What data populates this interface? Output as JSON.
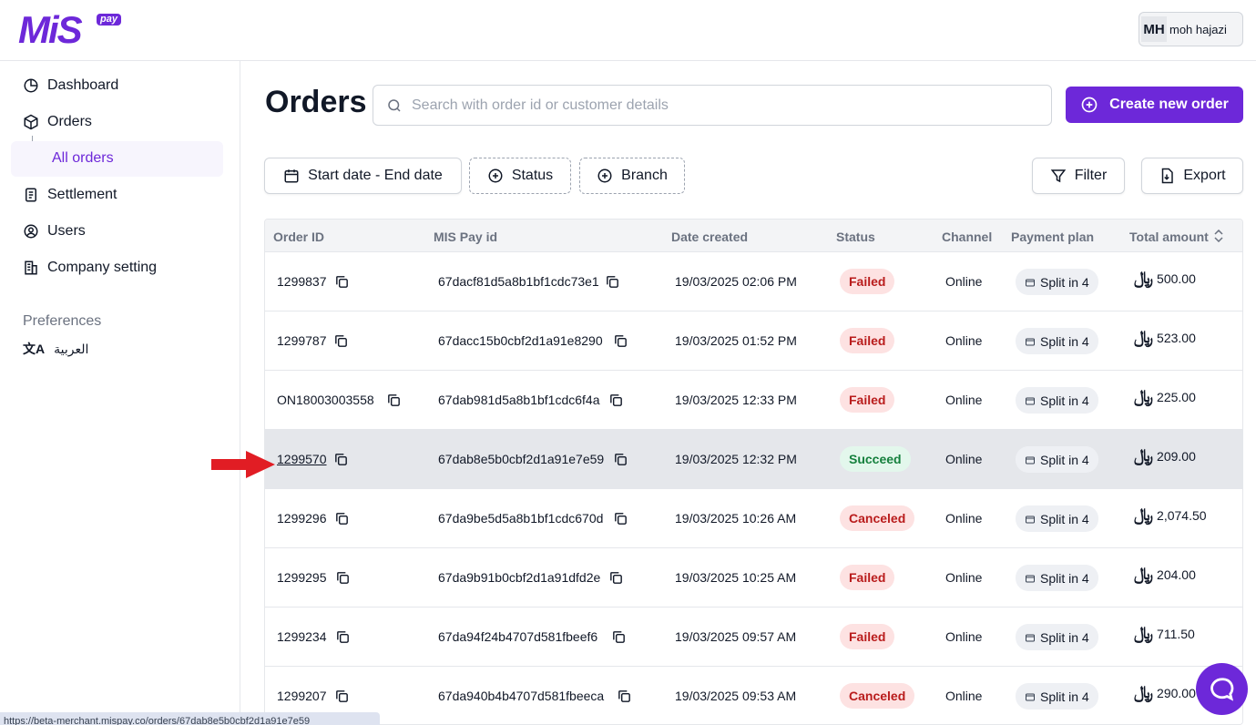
{
  "brand": {
    "logo_text": "MiS",
    "logo_badge": "pay",
    "accent": "#6d28d9"
  },
  "user": {
    "initials": "MH",
    "name": "moh hajazi"
  },
  "sidebar": {
    "items": [
      {
        "label": "Dashboard",
        "icon": "chart-pie-icon"
      },
      {
        "label": "Orders",
        "icon": "box-icon"
      },
      {
        "label": "Settlement",
        "icon": "document-icon"
      },
      {
        "label": "Users",
        "icon": "user-circle-icon"
      },
      {
        "label": "Company setting",
        "icon": "building-icon"
      }
    ],
    "sub_item": "All orders",
    "preferences_label": "Preferences",
    "language_label": "العربية"
  },
  "page": {
    "title": "Orders",
    "search_placeholder": "Search with order id or customer details",
    "create_button": "Create new order"
  },
  "filters": {
    "date": "Start date - End date",
    "status": "Status",
    "branch": "Branch",
    "filter": "Filter",
    "export": "Export"
  },
  "table": {
    "columns": [
      "Order ID",
      "MIS Pay id",
      "Date created",
      "Status",
      "Channel",
      "Payment plan",
      "Total amount"
    ],
    "rows": [
      {
        "order_id": "1299837",
        "mis_id": "67dacf81d5a8b1bf1cdc73e1",
        "date": "19/03/2025 02:06 PM",
        "status": "Failed",
        "channel": "Online",
        "plan": "Split in 4",
        "amount": "500.00"
      },
      {
        "order_id": "1299787",
        "mis_id": "67dacc15b0cbf2d1a91e8290",
        "date": "19/03/2025 01:52 PM",
        "status": "Failed",
        "channel": "Online",
        "plan": "Split in 4",
        "amount": "523.00"
      },
      {
        "order_id": "ON18003003558",
        "mis_id": "67dab981d5a8b1bf1cdc6f4a",
        "date": "19/03/2025 12:33 PM",
        "status": "Failed",
        "channel": "Online",
        "plan": "Split in 4",
        "amount": "225.00"
      },
      {
        "order_id": "1299570",
        "mis_id": "67dab8e5b0cbf2d1a91e7e59",
        "date": "19/03/2025 12:32 PM",
        "status": "Succeed",
        "channel": "Online",
        "plan": "Split in 4",
        "amount": "209.00"
      },
      {
        "order_id": "1299296",
        "mis_id": "67da9be5d5a8b1bf1cdc670d",
        "date": "19/03/2025 10:26 AM",
        "status": "Canceled",
        "channel": "Online",
        "plan": "Split in 4",
        "amount": "2,074.50"
      },
      {
        "order_id": "1299295",
        "mis_id": "67da9b91b0cbf2d1a91dfd2e",
        "date": "19/03/2025 10:25 AM",
        "status": "Failed",
        "channel": "Online",
        "plan": "Split in 4",
        "amount": "204.00"
      },
      {
        "order_id": "1299234",
        "mis_id": "67da94f24b4707d581fbeef6",
        "date": "19/03/2025 09:57 AM",
        "status": "Failed",
        "channel": "Online",
        "plan": "Split in 4",
        "amount": "711.50"
      },
      {
        "order_id": "1299207",
        "mis_id": "67da940b4b4707d581fbeeca",
        "date": "19/03/2025 09:53 AM",
        "status": "Canceled",
        "channel": "Online",
        "plan": "Split in 4",
        "amount": "290.00"
      }
    ],
    "currency_symbol": "﷼"
  },
  "status_bar_url": "https://beta-merchant.mispay.co/orders/67dab8e5b0cbf2d1a91e7e59"
}
